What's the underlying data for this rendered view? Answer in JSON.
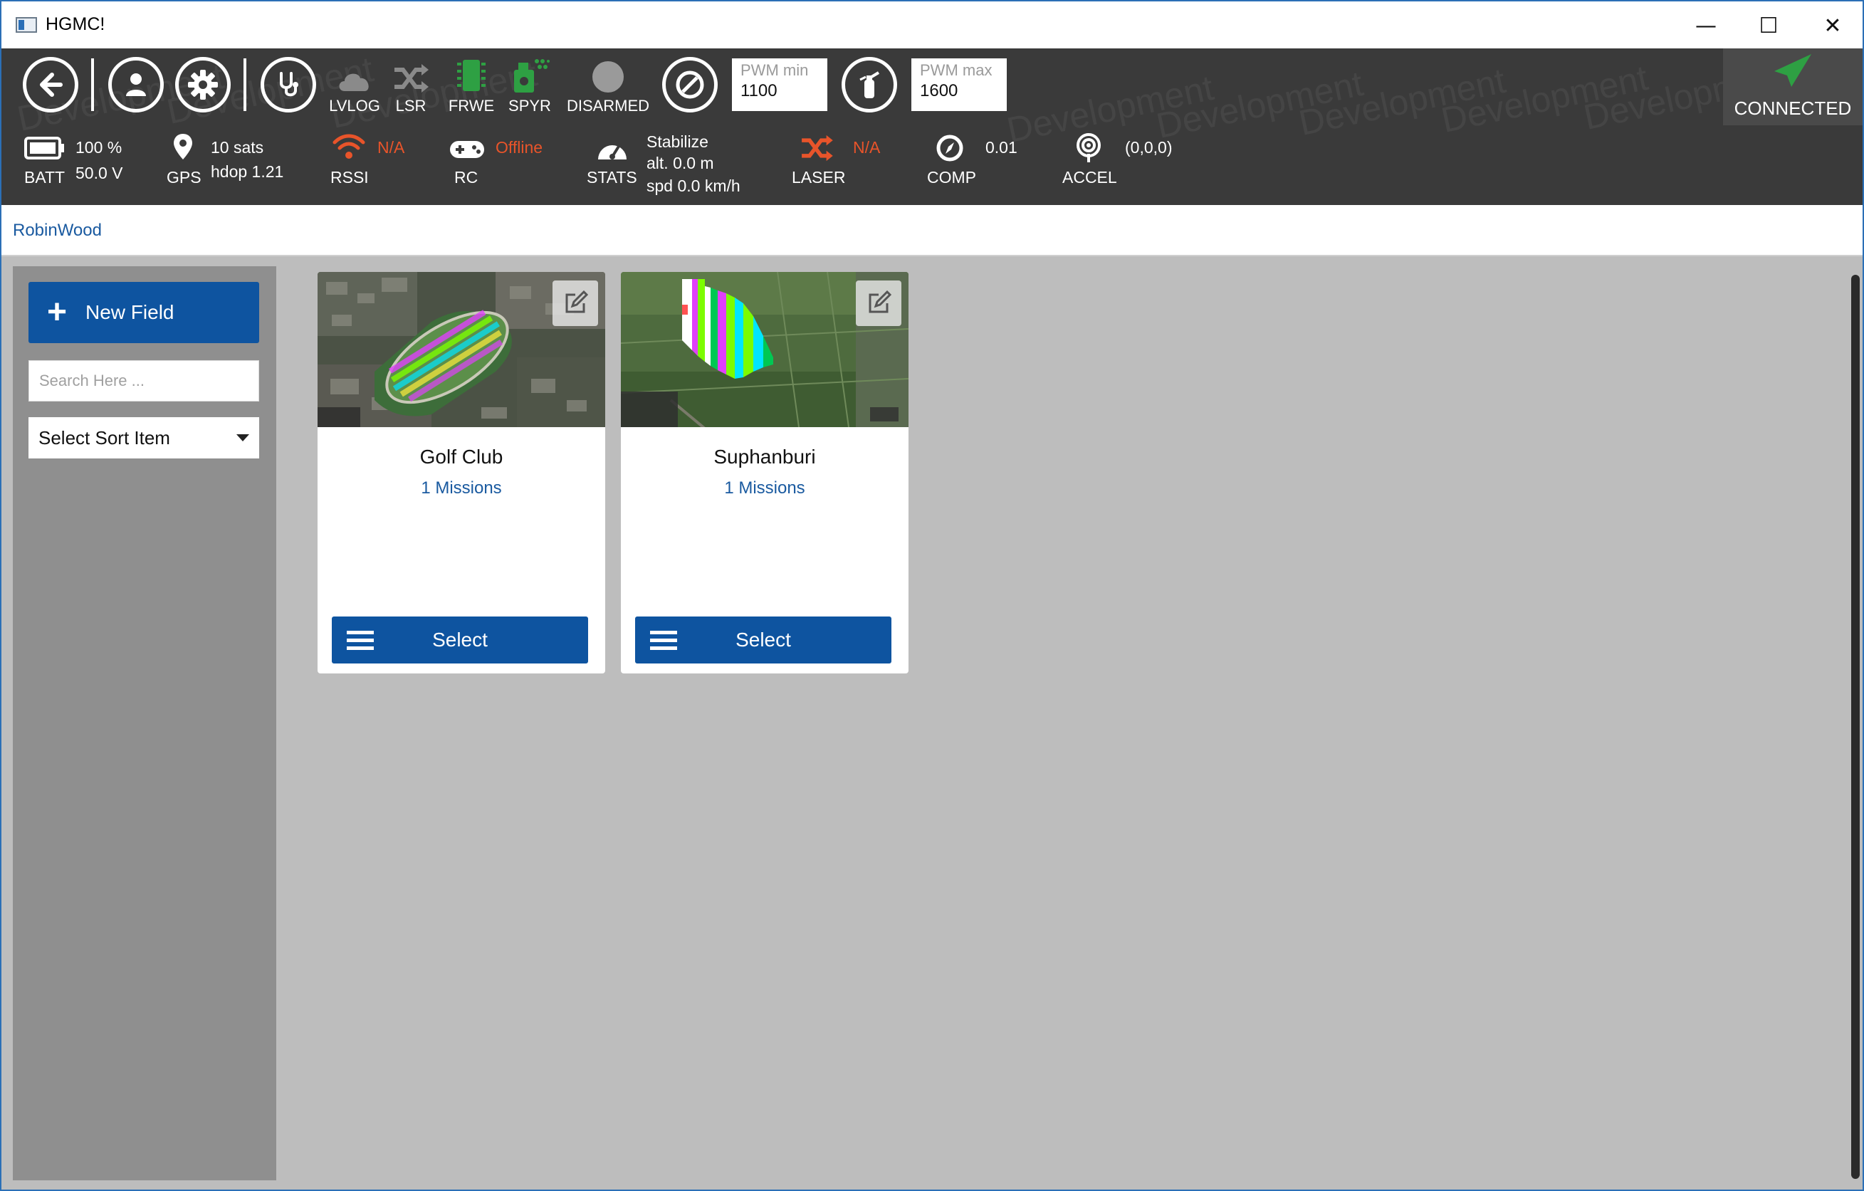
{
  "window": {
    "title": "HGMC!",
    "controls": {
      "minimize": "—",
      "maximize": "☐",
      "close": "✕"
    }
  },
  "toolbar": {
    "buttons": [
      {
        "name": "back",
        "icon": "arrow-left-icon"
      },
      {
        "name": "profile",
        "icon": "user-icon"
      },
      {
        "name": "settings",
        "icon": "gear-icon"
      },
      {
        "name": "diagnostics",
        "icon": "stethoscope-icon"
      }
    ],
    "tools": [
      {
        "label": "LVLOG",
        "icon": "cloud-icon",
        "color": "#8a8a8a"
      },
      {
        "label": "LSR",
        "icon": "shuffle-icon",
        "color": "#8a8a8a"
      },
      {
        "label": "FRWE",
        "icon": "chip-icon",
        "color": "#2ea043"
      },
      {
        "label": "SPYR",
        "icon": "sprayer-icon",
        "color": "#2ea043"
      },
      {
        "label": "DISARMED",
        "icon": "status-dot-icon",
        "color": "#9a9a9a"
      }
    ],
    "pwm_min": {
      "placeholder": "PWM min",
      "value": "1100"
    },
    "pwm_max": {
      "placeholder": "PWM max",
      "value": "1600"
    },
    "connection": {
      "label": "CONNECTED",
      "color": "#2ea043"
    },
    "watermark": "Development"
  },
  "telemetry": {
    "batt": {
      "label": "BATT",
      "percent": "100 %",
      "voltage": "50.0 V"
    },
    "gps": {
      "label": "GPS",
      "sats": "10 sats",
      "hdop": "hdop 1.21"
    },
    "rssi": {
      "label": "RSSI",
      "value": "N/A"
    },
    "rc": {
      "label": "RC",
      "value": "Offline"
    },
    "stats": {
      "label": "STATS",
      "mode": "Stabilize",
      "alt": "alt. 0.0 m",
      "spd": "spd 0.0 km/h"
    },
    "laser": {
      "label": "LASER",
      "value": "N/A"
    },
    "comp": {
      "label": "COMP",
      "value": "0.01"
    },
    "accel": {
      "label": "ACCEL",
      "value": "(0,0,0)"
    }
  },
  "breadcrumb": "RobinWood",
  "sidebar": {
    "new_field_label": "New Field",
    "search_placeholder": "Search Here ...",
    "sort_label": "Select Sort Item"
  },
  "fields": [
    {
      "name": "Golf Club",
      "missions": "1 Missions",
      "select_label": "Select"
    },
    {
      "name": "Suphanburi",
      "missions": "1 Missions",
      "select_label": "Select"
    }
  ],
  "colors": {
    "accent": "#0e54a0",
    "warning": "#e8542a",
    "ok": "#2ea043",
    "toolbar_bg": "#3a3a3a"
  }
}
